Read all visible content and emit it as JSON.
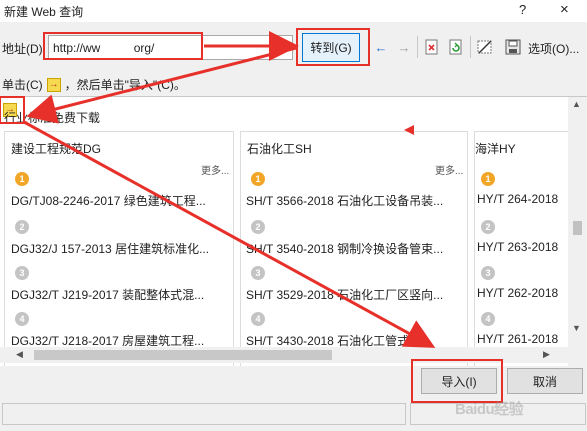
{
  "titlebar": {
    "title": "新建 Web 查询",
    "help": "?",
    "close": "×"
  },
  "toolbar": {
    "address_label": "地址(D):",
    "address_value": "http://ww          org/",
    "go_label": "转到(G)",
    "back_icon": "←",
    "forward_icon": "→",
    "options_label": "选项(O)..."
  },
  "hint": {
    "prefix": "单击(C)",
    "suffix": "，然后单击\"导入\"(C)。"
  },
  "page": {
    "section_title": "行业标准免费下载",
    "columns": [
      {
        "header": "建设工程规范DG",
        "more": "更多...",
        "items": [
          {
            "rank": "1",
            "text": "DG/TJ08-2246-2017 绿色建筑工程..."
          },
          {
            "rank": "2",
            "text": "DGJ32/J 157-2013 居住建筑标准化..."
          },
          {
            "rank": "3",
            "text": "DGJ32/T J219-2017 装配整体式混..."
          },
          {
            "rank": "4",
            "text": "DGJ32/T J218-2017 房屋建筑工程..."
          }
        ]
      },
      {
        "header": "石油化工SH",
        "more": "更多...",
        "items": [
          {
            "rank": "1",
            "text": "SH/T 3566-2018 石油化工设备吊装..."
          },
          {
            "rank": "2",
            "text": "SH/T 3540-2018 钢制冷换设备管束..."
          },
          {
            "rank": "3",
            "text": "SH/T 3529-2018 石油化工厂区竖向..."
          },
          {
            "rank": "4",
            "text": "SH/T 3430-2018 石油化工管式换..."
          }
        ]
      },
      {
        "header": "海洋HY",
        "more": "",
        "items": [
          {
            "rank": "1",
            "text": "HY/T 264-2018"
          },
          {
            "rank": "2",
            "text": "HY/T 263-2018"
          },
          {
            "rank": "3",
            "text": "HY/T 262-2018"
          },
          {
            "rank": "4",
            "text": "HY/T 261-2018"
          }
        ]
      }
    ]
  },
  "buttons": {
    "import": "导入(I)",
    "cancel": "取消"
  },
  "watermark": "Baidu经验",
  "colors": {
    "annotation_red": "#e8302a",
    "go_border": "#0078d7",
    "badge_gold": "#f1a628",
    "badge_gray": "#c4c4c4"
  }
}
